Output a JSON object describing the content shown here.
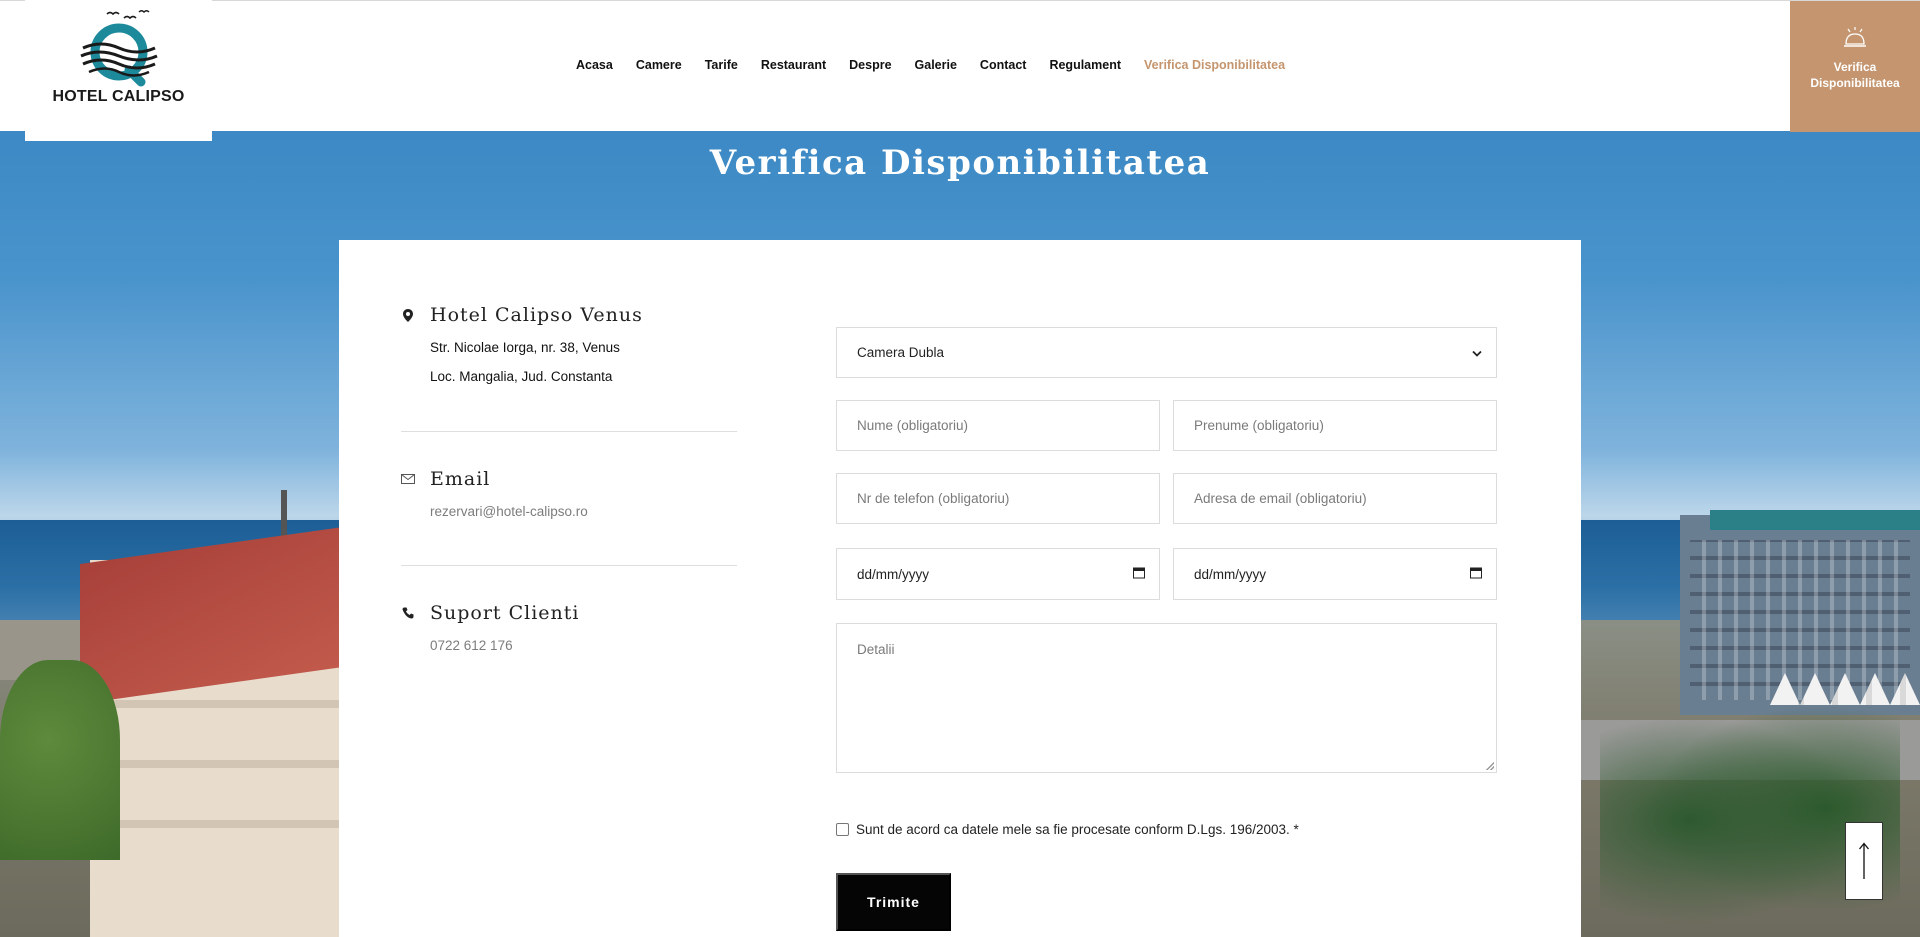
{
  "brand": {
    "name": "HOTEL CALIPSO",
    "accent": "#c4956e"
  },
  "nav": {
    "items": [
      {
        "label": "Acasa"
      },
      {
        "label": "Camere"
      },
      {
        "label": "Tarife"
      },
      {
        "label": "Restaurant"
      },
      {
        "label": "Despre"
      },
      {
        "label": "Galerie"
      },
      {
        "label": "Contact"
      },
      {
        "label": "Regulament"
      },
      {
        "label": "Verifica Disponibilitatea",
        "active": true
      }
    ]
  },
  "cta": {
    "line1": "Verifica",
    "line2": "Disponibilitatea",
    "icon": "cloche-icon"
  },
  "page": {
    "title": "Verifica Disponibilitatea"
  },
  "contact": {
    "hotel": {
      "title": "Hotel Calipso Venus",
      "address1": "Str. Nicolae Iorga, nr. 38, Venus",
      "address2": "Loc. Mangalia, Jud. Constanta",
      "icon": "map-pin-icon"
    },
    "email": {
      "title": "Email",
      "value": "rezervari@hotel-calipso.ro",
      "icon": "envelope-icon"
    },
    "support": {
      "title": "Suport Clienti",
      "value": "0722 612 176",
      "icon": "phone-icon"
    }
  },
  "form": {
    "room_select": {
      "value": "Camera Dubla"
    },
    "first_name": {
      "placeholder": "Nume (obligatoriu)"
    },
    "last_name": {
      "placeholder": "Prenume (obligatoriu)"
    },
    "phone": {
      "placeholder": "Nr de telefon (obligatoriu)"
    },
    "email": {
      "placeholder": "Adresa de email (obligatoriu)"
    },
    "checkin": {
      "value": "dd/mm/yyyy"
    },
    "checkout": {
      "value": "dd/mm/yyyy"
    },
    "details": {
      "placeholder": "Detalii"
    },
    "consent": {
      "label": "Sunt de acord ca datele mele sa fie procesate conform D.Lgs. 196/2003. *"
    },
    "submit": {
      "label": "Trimite"
    }
  },
  "scroll_top": {
    "icon": "arrow-up-icon"
  }
}
